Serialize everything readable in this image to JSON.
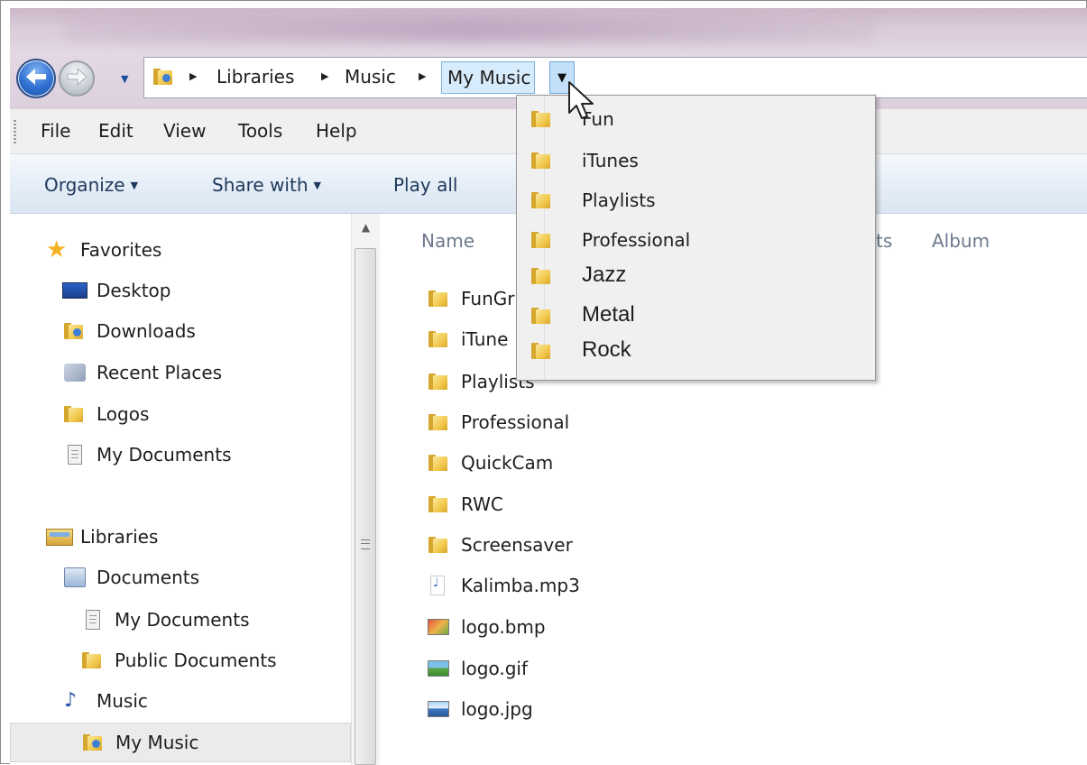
{
  "breadcrumb": {
    "items": [
      "Libraries",
      "Music"
    ],
    "current": "My Music"
  },
  "menubar": {
    "items": [
      "File",
      "Edit",
      "View",
      "Tools",
      "Help"
    ]
  },
  "command_bar": {
    "organize": "Organize",
    "share_with": "Share with",
    "play_all": "Play all"
  },
  "nav_pane": {
    "favorites": {
      "header": "Favorites",
      "items": [
        "Desktop",
        "Downloads",
        "Recent Places",
        "Logos",
        "My Documents"
      ]
    },
    "libraries": {
      "header": "Libraries",
      "documents": "Documents",
      "documents_children": [
        "My Documents",
        "Public Documents"
      ],
      "music": "Music",
      "music_children": [
        "My Music"
      ]
    }
  },
  "file_list": {
    "columns": [
      "Name",
      "ts",
      "Album"
    ],
    "rows": [
      "FunGr",
      "iTune",
      "Playlists",
      "Professional",
      "QuickCam",
      "RWC",
      "Screensaver",
      "Kalimba.mp3",
      "logo.bmp",
      "logo.gif",
      "logo.jpg"
    ]
  },
  "dropdown": {
    "items": [
      "Fun",
      "iTunes",
      "Playlists",
      "Professional",
      "Jazz",
      "Metal",
      "Rock"
    ]
  },
  "colors": {
    "accent_highlight": "#d6ebfb",
    "command_text": "#1e395b",
    "folder": "#f1c74b"
  }
}
